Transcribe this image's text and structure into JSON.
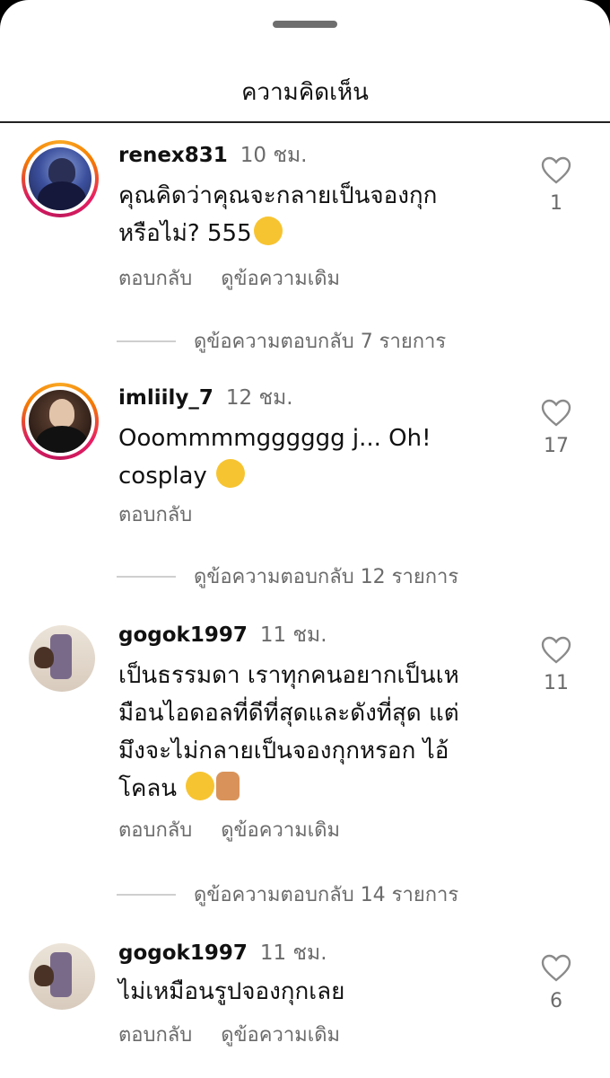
{
  "header": {
    "title": "ความคิดเห็น"
  },
  "comments": [
    {
      "username": "renex831",
      "time": "10 ชม.",
      "text": "คุณคิดว่าคุณจะกลายเป็นจองกุก หรือไม่? 555",
      "line1": "คุณคิดว่าคุณจะกลายเป็นจองกุก",
      "line2": "หรือไม่? 555",
      "emoji": "laughing-tears-emoji",
      "reply": "ตอบกลับ",
      "view_original": "ดูข้อความเดิม",
      "likes": "1",
      "replies": "ดูข้อความตอบกลับ 7 รายการ"
    },
    {
      "username": "imliily_7",
      "time": "12 ชม.",
      "line1": "Ooommmmgggggg j... Oh!",
      "line2": "cosplay",
      "emoji": "crying-face-emoji",
      "reply": "ตอบกลับ",
      "likes": "17",
      "replies": "ดูข้อความตอบกลับ 12 รายการ"
    },
    {
      "username": "gogok1997",
      "time": "11 ชม.",
      "line1": "เป็นธรรมดา เราทุกคนอยากเป็นเห",
      "line2": "มือนไอดอลที่ดีที่สุดและดังที่สุด แต่",
      "line3": "มึงจะไม่กลายเป็นจองกุกหรอก ไอ้",
      "line4": "โคลน",
      "emoji": "relieved-face-thumbs-up-emoji",
      "reply": "ตอบกลับ",
      "view_original": "ดูข้อความเดิม",
      "likes": "11",
      "replies": "ดูข้อความตอบกลับ 14 รายการ"
    },
    {
      "username": "gogok1997",
      "time": "11 ชม.",
      "line1": "ไม่เหมือนรูปจองกุกเลย",
      "reply": "ตอบกลับ",
      "view_original": "ดูข้อความเดิม",
      "likes": "6"
    }
  ]
}
